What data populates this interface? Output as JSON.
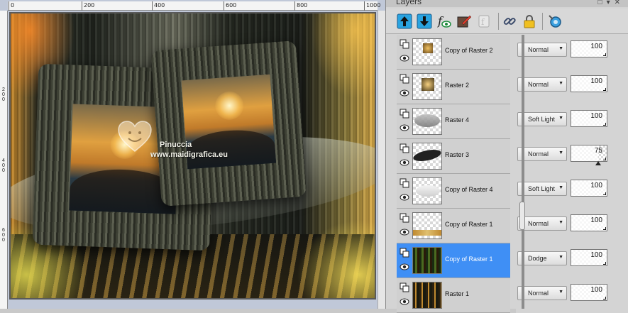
{
  "palette": {
    "title": "Layers"
  },
  "ruler": {
    "top_labels": [
      "0",
      "200",
      "400",
      "600",
      "800",
      "1000"
    ],
    "left_labels": [
      "2",
      "0",
      "0",
      "4",
      "0",
      "0",
      "6",
      "0",
      "0"
    ]
  },
  "watermark": {
    "line1": "Pinuccia",
    "line2": "www.maidigrafica.eu"
  },
  "toolbar": {
    "icons": [
      "move-layer-up-icon",
      "move-layer-down-icon",
      "visibility-toggle-icon",
      "edit-selection-icon",
      "mask-icon",
      "link-icon",
      "lock-icon",
      "layer-properties-icon"
    ]
  },
  "colors": {
    "selected_row": "#3f8ff5",
    "palette_bg": "#d4d4d4"
  },
  "layers": [
    {
      "name": "Copy of Raster 2",
      "blend": "Normal",
      "opacity": "100",
      "opacity_value": 100,
      "selected": false
    },
    {
      "name": "Raster 2",
      "blend": "Normal",
      "opacity": "100",
      "opacity_value": 100,
      "selected": false
    },
    {
      "name": "Raster 4",
      "blend": "Soft Light",
      "opacity": "100",
      "opacity_value": 100,
      "selected": false
    },
    {
      "name": "Raster 3",
      "blend": "Normal",
      "opacity": "75",
      "opacity_value": 75,
      "selected": false
    },
    {
      "name": "Copy of Raster 4",
      "blend": "Soft Light",
      "opacity": "100",
      "opacity_value": 100,
      "selected": false
    },
    {
      "name": "Copy of Raster 1",
      "blend": "Normal",
      "opacity": "100",
      "opacity_value": 100,
      "selected": false
    },
    {
      "name": "Copy of Raster 1",
      "blend": "Dodge",
      "opacity": "100",
      "opacity_value": 100,
      "selected": true
    },
    {
      "name": "Raster 1",
      "blend": "Normal",
      "opacity": "100",
      "opacity_value": 100,
      "selected": false
    }
  ]
}
